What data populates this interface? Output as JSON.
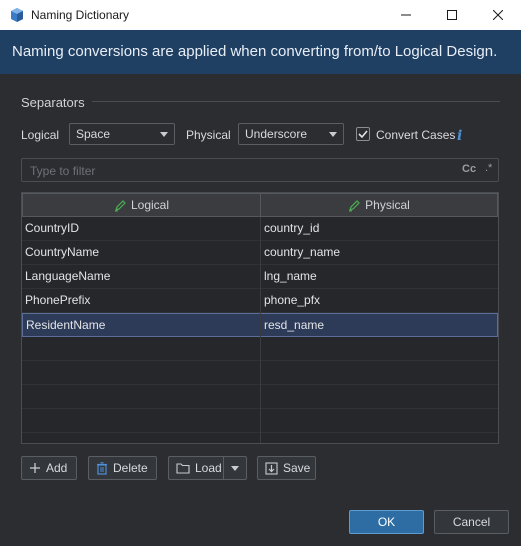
{
  "window": {
    "title": "Naming Dictionary",
    "app_icon": "database-cube-icon",
    "controls": [
      "minimize-icon",
      "maximize-icon",
      "close-icon"
    ]
  },
  "banner": {
    "text": "Naming conversions are applied when converting from/to Logical Design."
  },
  "separators": {
    "section_label": "Separators",
    "logical_label": "Logical",
    "logical_value": "Space",
    "physical_label": "Physical",
    "physical_value": "Underscore",
    "convert_cases_label": "Convert Cases",
    "convert_cases_checked": true,
    "info_icon": "i"
  },
  "filter": {
    "placeholder": "Type to filter",
    "case_toggle": "Cc",
    "regex_toggle": ".*"
  },
  "table": {
    "columns": [
      "Logical",
      "Physical"
    ],
    "rows": [
      {
        "logical": "CountryID",
        "physical": "country_id"
      },
      {
        "logical": "CountryName",
        "physical": "country_name"
      },
      {
        "logical": "LanguageName",
        "physical": "lng_name"
      },
      {
        "logical": "PhonePrefix",
        "physical": "phone_pfx"
      },
      {
        "logical": "ResidentName",
        "physical": "resd_name"
      }
    ],
    "selected_row": 4,
    "empty_rows": 5
  },
  "toolbar": {
    "add_label": "Add",
    "delete_label": "Delete",
    "load_label": "Load",
    "save_label": "Save"
  },
  "footer": {
    "ok_label": "OK",
    "cancel_label": "Cancel"
  },
  "colors": {
    "banner_bg": "#1f3f63",
    "accent_blue": "#2e6da4",
    "selected_row_bg": "#2e3b58",
    "pencil_green": "#4caf50"
  }
}
